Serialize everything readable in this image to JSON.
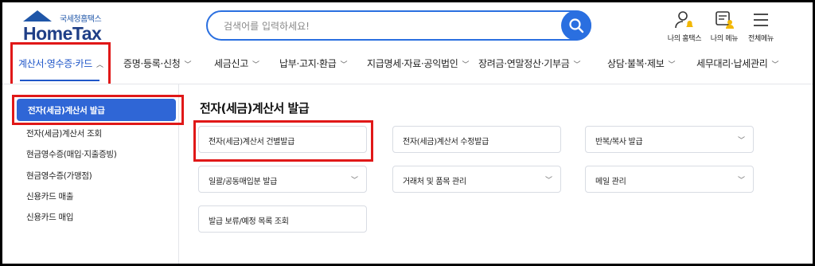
{
  "logo": {
    "subtitle": "국세청홈택스",
    "title": "HomeTax"
  },
  "search": {
    "placeholder": "검색어를 입력하세요!"
  },
  "utility": {
    "my_hometax": "나의 홈택스",
    "my_menu": "나의 메뉴",
    "all_menu": "전체메뉴"
  },
  "nav": {
    "items": [
      "계산서·영수증·카드",
      "증명·등록·신청",
      "세금신고",
      "납부·고지·환급",
      "지급명세·자료·공익법인",
      "장려금·연말정산·기부금",
      "상담·불복·제보",
      "세무대리·납세관리"
    ]
  },
  "sidebar": {
    "items": [
      "전자(세금)계산서 발급",
      "전자(세금)계산서 조회",
      "현금영수증(매입·지출증빙)",
      "현금영수증(가맹점)",
      "신용카드 매출",
      "신용카드 매입"
    ]
  },
  "main": {
    "title": "전자(세금)계산서 발급",
    "cards": [
      "전자(세금)계산서 건별발급",
      "전자(세금)계산서 수정발급",
      "반복/복사 발급",
      "일괄/공동매입분 발급",
      "거래처 및 품목 관리",
      "메일 관리",
      "발급 보류/예정 목록 조회"
    ]
  },
  "colors": {
    "accent": "#2f66d6",
    "highlight": "#e01818",
    "brand": "#1f3f87"
  }
}
